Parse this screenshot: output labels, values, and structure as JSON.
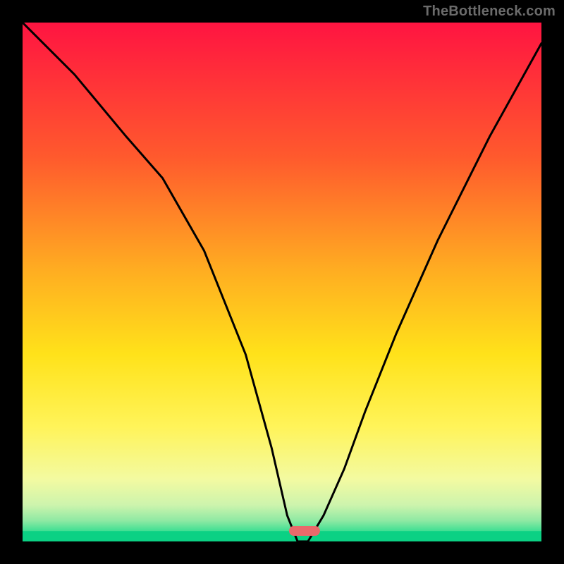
{
  "watermark": "TheBottleneck.com",
  "chart_data": {
    "type": "line",
    "title": "",
    "xlabel": "",
    "ylabel": "",
    "xlim": [
      0,
      100
    ],
    "ylim": [
      0,
      100
    ],
    "grid": false,
    "legend": false,
    "series": [
      {
        "name": "bottleneck-curve",
        "x": [
          0,
          10,
          20,
          27,
          35,
          43,
          48,
          51,
          53,
          55,
          58,
          62,
          66,
          72,
          80,
          90,
          100
        ],
        "values": [
          100,
          90,
          78,
          70,
          56,
          36,
          18,
          5,
          0,
          0,
          5,
          14,
          25,
          40,
          58,
          78,
          96
        ]
      }
    ],
    "marker": {
      "x_center": 54.3,
      "width_pct": 6.0
    },
    "gradient_stops": [
      {
        "pct": 0,
        "color": "#ff1441"
      },
      {
        "pct": 26,
        "color": "#ff5a2d"
      },
      {
        "pct": 48,
        "color": "#ffae21"
      },
      {
        "pct": 64,
        "color": "#ffe21a"
      },
      {
        "pct": 78,
        "color": "#fff45a"
      },
      {
        "pct": 88,
        "color": "#f3faa1"
      },
      {
        "pct": 93,
        "color": "#cdf4ad"
      },
      {
        "pct": 96,
        "color": "#8ee9a3"
      },
      {
        "pct": 98,
        "color": "#3fdf93"
      },
      {
        "pct": 100,
        "color": "#0bd184"
      }
    ],
    "bottom_band_height_pct": 2.0,
    "bottom_band_color": "#0bd184"
  }
}
